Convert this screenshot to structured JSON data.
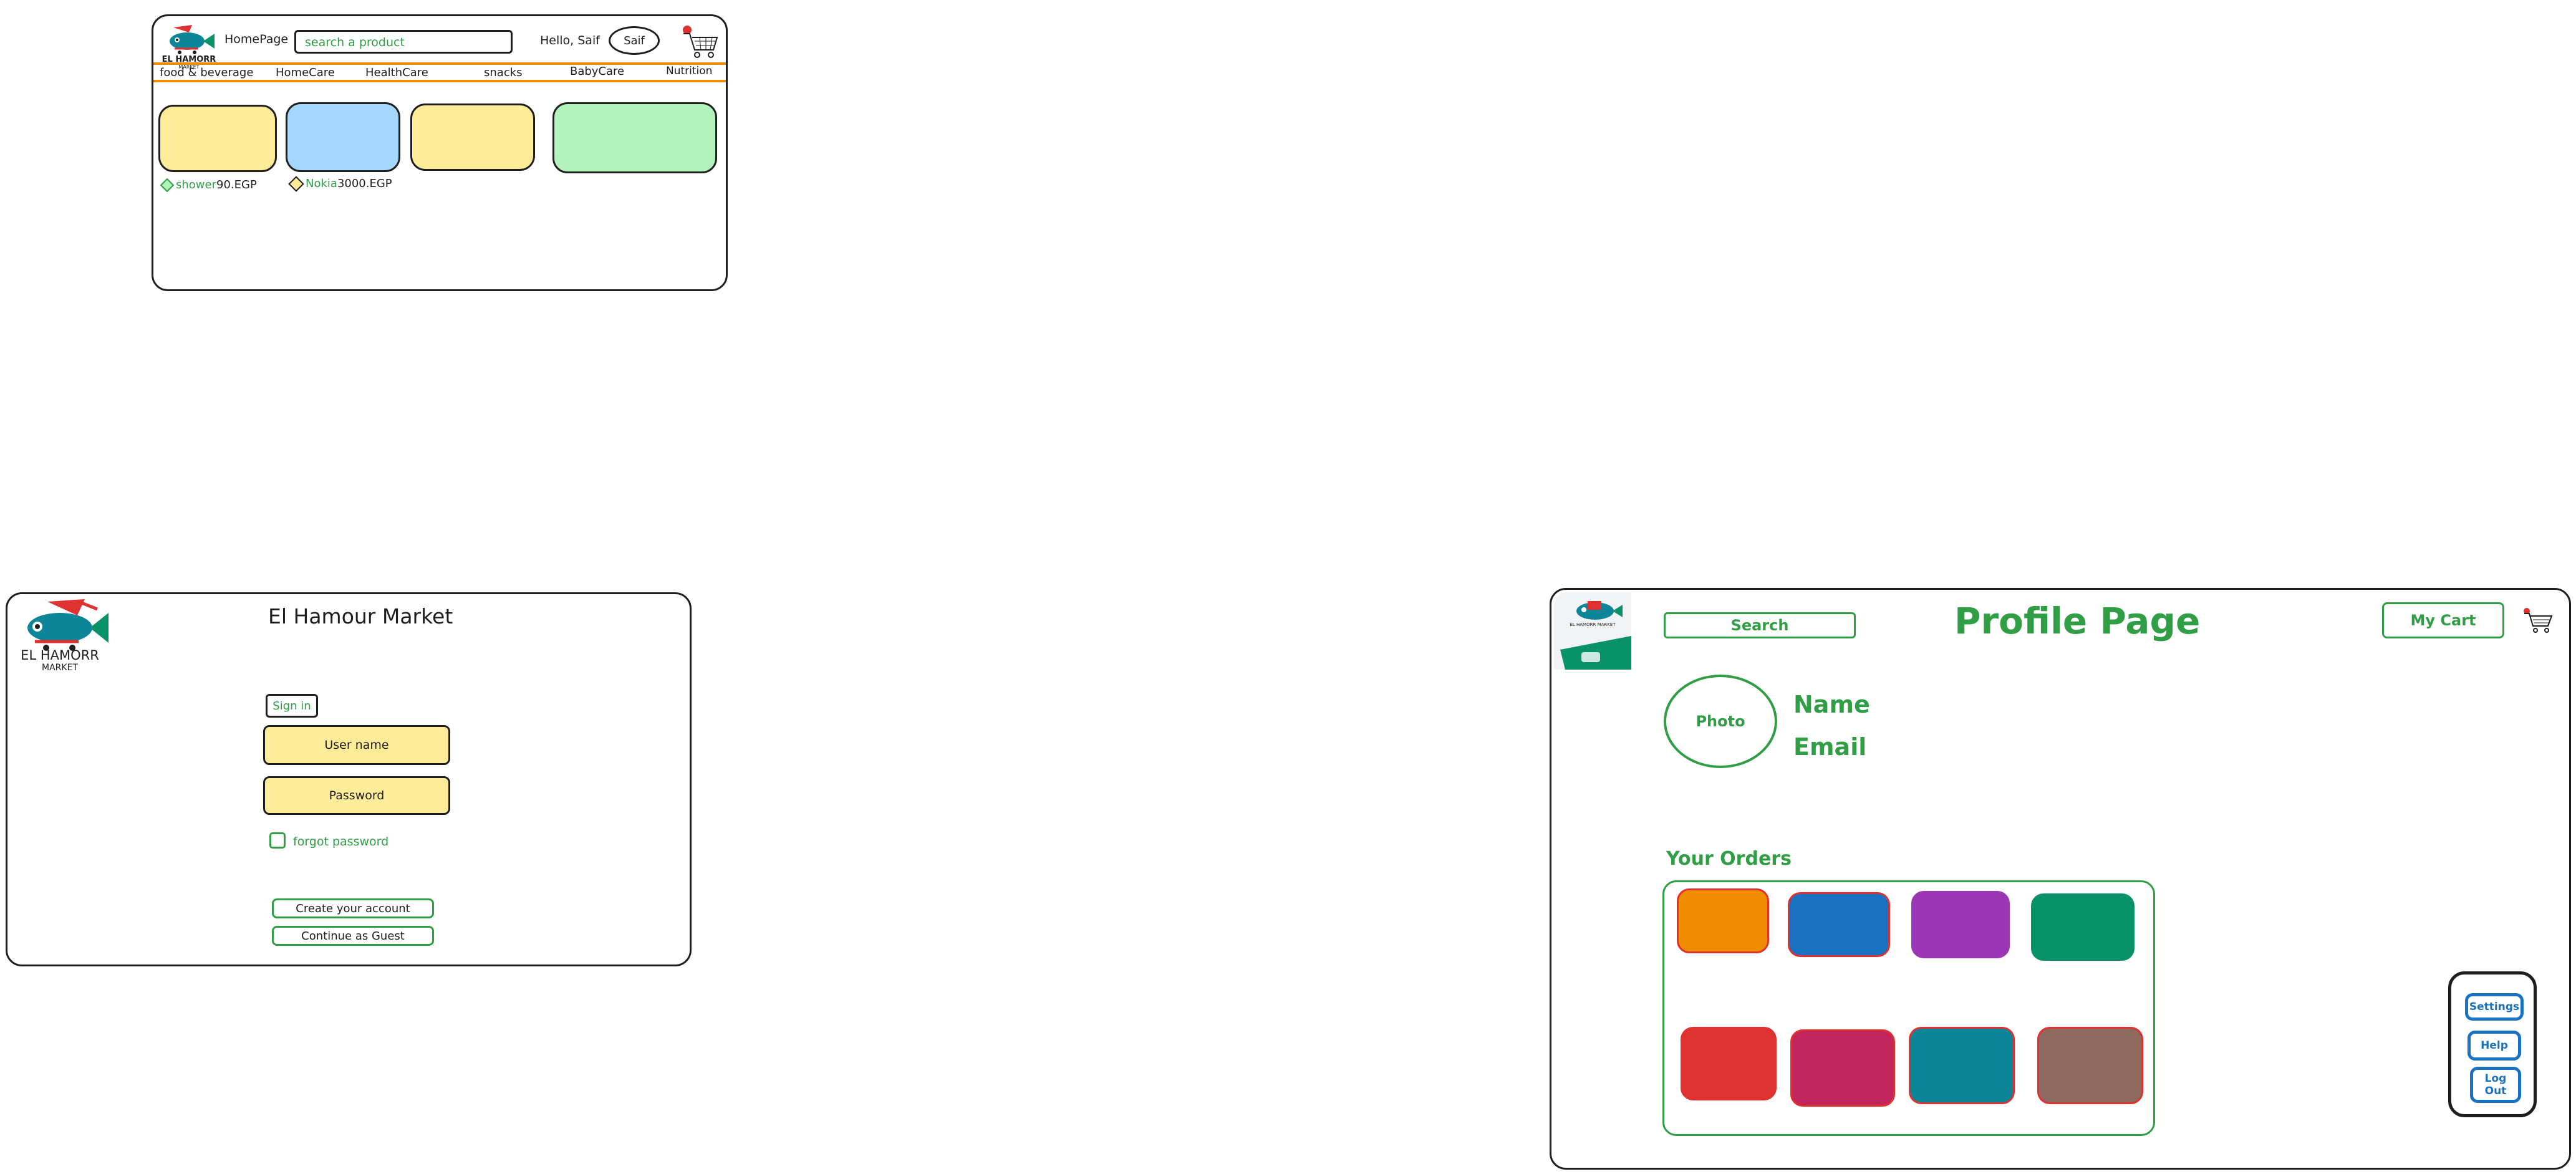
{
  "home": {
    "nav_home": "HomePage",
    "search_placeholder": "search a product",
    "greeting": "Hello, Saif",
    "user_button": "Saif",
    "logo_title": "EL HAMORR",
    "logo_sub": "MARKET",
    "categories": [
      "food & beverage",
      "HomeCare",
      "HealthCare",
      "snacks",
      "BabyCare",
      "Nutrition"
    ],
    "products": [
      {
        "name": "shower",
        "price": "90.EGP"
      },
      {
        "name": "Nokia",
        "price": "3000.EGP"
      }
    ],
    "colors": {
      "accent": "#f08c00",
      "yellow": "#ffec99",
      "blue": "#a5d8ff",
      "green": "#b2f2bb",
      "badge": "#e03131"
    }
  },
  "login": {
    "title": "El Hamour Market",
    "logo_title": "EL HAMORR",
    "logo_sub": "MARKET",
    "sign_in": "Sign in",
    "username": "User name",
    "password": "Password",
    "forgot": "forgot password",
    "create": "Create your account",
    "guest": "Continue as Guest"
  },
  "profile": {
    "search": "Search",
    "title": "Profile Page",
    "cart": "My Cart",
    "photo": "Photo",
    "name": "Name",
    "email": "Email",
    "orders_title": "Your Orders",
    "order_colors": [
      "#f08c00",
      "#1971c2",
      "#9c36b5",
      "#099268",
      "#e03131",
      "#c2255c",
      "#0c8599",
      "#8c6a5f"
    ],
    "menu": [
      "Settings",
      "Help",
      "Log Out"
    ]
  }
}
